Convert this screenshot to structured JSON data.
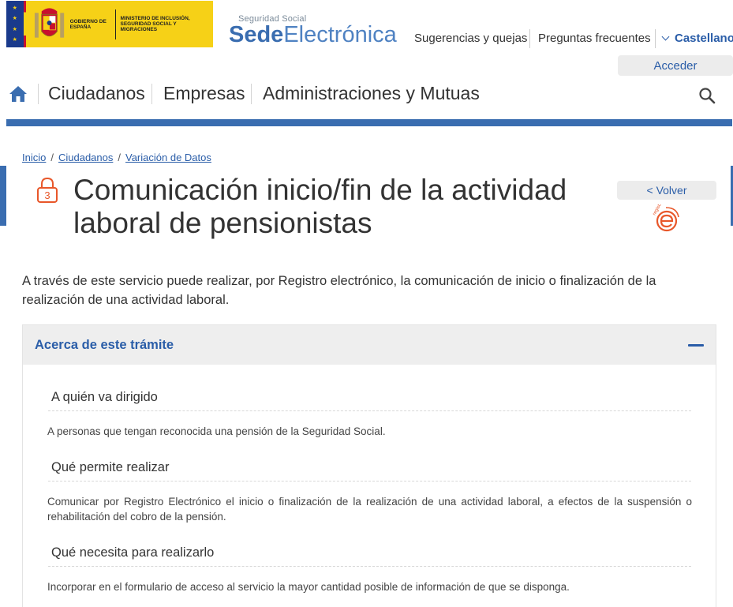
{
  "header": {
    "gov_logo": {
      "gobierno": "GOBIERNO DE ESPAÑA",
      "ministerio": "MINISTERIO DE INCLUSIÓN, SEGURIDAD SOCIAL Y MIGRACIONES"
    },
    "brand": {
      "subtitle": "Seguridad Social",
      "name_bold": "Sede",
      "name_light": "Electrónica"
    },
    "top_links": {
      "suggestions": "Sugerencias y quejas",
      "faq": "Preguntas frecuentes",
      "language": "Castellano"
    },
    "login_button": "Acceder"
  },
  "main_nav": {
    "items": [
      "Ciudadanos",
      "Empresas",
      "Administraciones y Mutuas"
    ]
  },
  "breadcrumb": [
    "Inicio",
    "Ciudadanos",
    "Variación de Datos"
  ],
  "page": {
    "security_level": "3",
    "title": "Comunicación inicio/fin de la actividad laboral de pensionistas",
    "back_button": "< Volver",
    "registro_label": "registro",
    "intro": "A través de este servicio puede realizar, por Registro electrónico, la comunicación de inicio o finalización de la realización de una actividad laboral."
  },
  "accordion": {
    "title": "Acerca de este trámite",
    "sections": [
      {
        "title": "A quién va dirigido",
        "text": "A personas que tengan reconocida una pensión de la Seguridad Social."
      },
      {
        "title": "Qué permite realizar",
        "text": "Comunicar por Registro Electrónico el inicio o finalización de la realización de una actividad laboral, a efectos de la suspensión o rehabilitación del cobro de la pensión."
      },
      {
        "title": "Qué necesita para realizarlo",
        "text": "Incorporar en el formulario de acceso al servicio la mayor cantidad posible de información de que se disponga."
      }
    ]
  },
  "colors": {
    "brand_blue": "#3a6db0",
    "link_blue": "#2a5da8",
    "gov_yellow": "#f6d117",
    "accent_orange": "#e8572a"
  }
}
